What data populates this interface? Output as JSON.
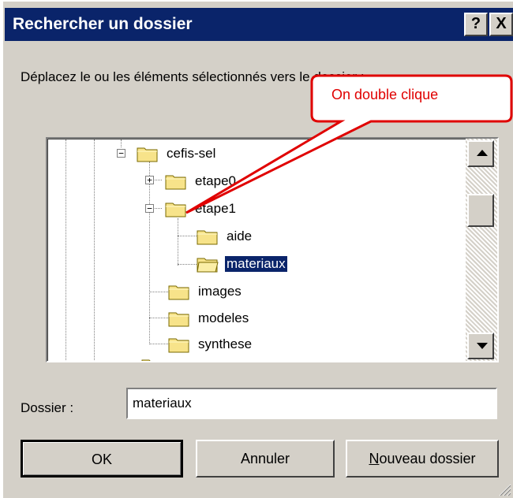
{
  "window": {
    "title": "Rechercher un dossier",
    "help_label": "?",
    "close_label": "X"
  },
  "instruction": "Déplacez le ou les  éléments sélectionnés vers le dossier :",
  "tree": {
    "nodes": [
      {
        "label": "cefis-sel",
        "expander": "−"
      },
      {
        "label": "etape0",
        "expander": "+"
      },
      {
        "label": "etape1",
        "expander": "−"
      },
      {
        "label": "aide"
      },
      {
        "label": "materiaux",
        "selected": true
      },
      {
        "label": "images"
      },
      {
        "label": "modeles"
      },
      {
        "label": "synthese"
      }
    ]
  },
  "folder_field": {
    "label": "Dossier :",
    "value": "materiaux"
  },
  "buttons": {
    "ok": "OK",
    "cancel": "Annuler",
    "new_folder_first": "N",
    "new_folder_rest": "ouveau dossier"
  },
  "annotation": {
    "text": "On double clique",
    "color": "#e00000"
  }
}
